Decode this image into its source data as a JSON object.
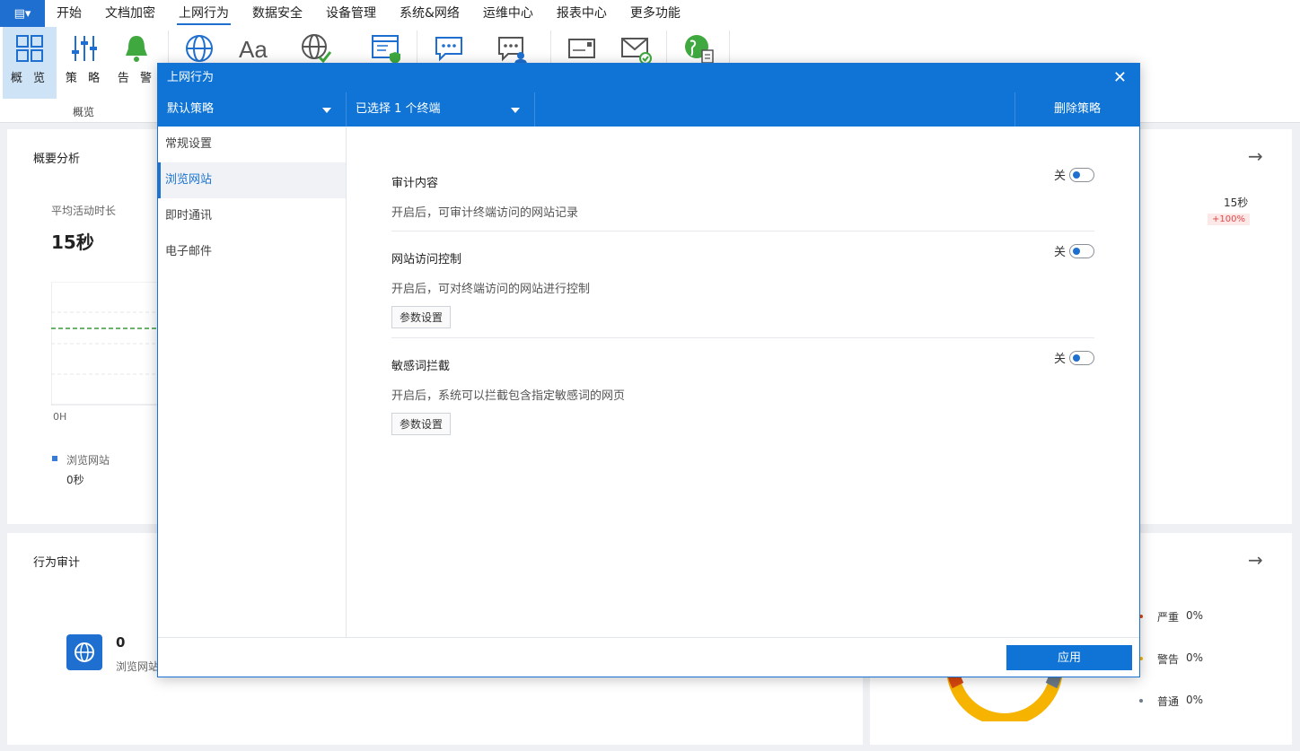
{
  "menubar": {
    "items": [
      "开始",
      "文档加密",
      "上网行为",
      "数据安全",
      "设备管理",
      "系统&网络",
      "运维中心",
      "报表中心",
      "更多功能"
    ],
    "active_index": 2
  },
  "ribbon": {
    "overview_label": "概 览",
    "policy_label": "策 略",
    "alert_label": "告 警",
    "group_label": "概览"
  },
  "summary_card": {
    "title": "概要分析",
    "metric_label": "平均活动时长",
    "metric_value": "15秒",
    "axis_start": "0H",
    "legend_label": "浏览网站",
    "legend_value": "0秒",
    "right_value": "15秒",
    "right_badge": "+100%"
  },
  "audit_card": {
    "title": "行为审计",
    "count": "0",
    "count_label": "浏览网站"
  },
  "severity": {
    "items": [
      {
        "label": "严重",
        "value": "0%"
      },
      {
        "label": "警告",
        "value": "0%"
      },
      {
        "label": "普通",
        "value": "0%"
      }
    ]
  },
  "dialog": {
    "title": "上网行为",
    "policy_select": "默认策略",
    "terminal_select": "已选择 1 个终端",
    "delete_label": "删除策略",
    "sidebar": [
      "常规设置",
      "浏览网站",
      "即时通讯",
      "电子邮件"
    ],
    "sidebar_active": 1,
    "settings": [
      {
        "name": "审计内容",
        "desc": "开启后，可审计终端访问的网站记录",
        "toggle": "关"
      },
      {
        "name": "网站访问控制",
        "desc": "开启后，可对终端访问的网站进行控制",
        "toggle": "关",
        "param": "参数设置"
      },
      {
        "name": "敏感词拦截",
        "desc": "开启后，系统可以拦截包含指定敏感词的网页",
        "toggle": "关",
        "param": "参数设置"
      }
    ],
    "apply_label": "应用"
  },
  "colors": {
    "primary": "#0f74d6",
    "ribbon_selected": "#cfe3f7",
    "chart_line": "#3a9a3a",
    "badge_red": "#e04848",
    "donut_yellow": "#f6b400"
  }
}
